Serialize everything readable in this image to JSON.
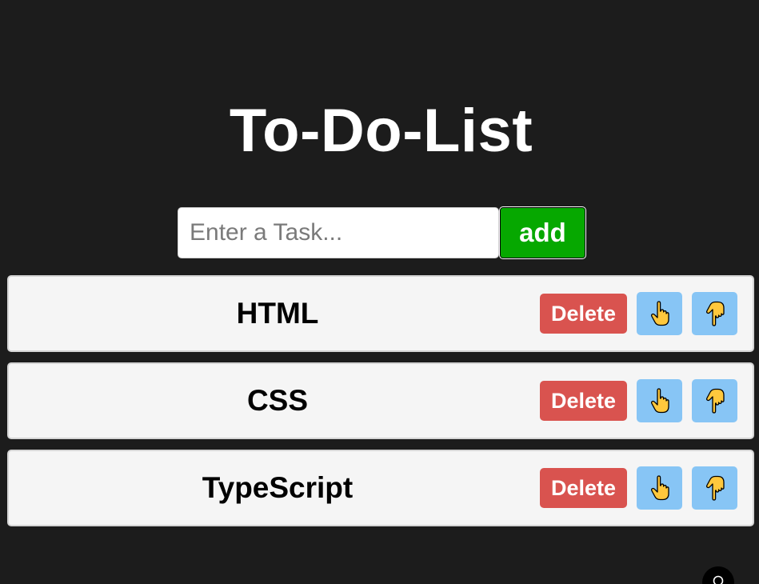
{
  "app": {
    "title": "To-Do-List"
  },
  "input": {
    "placeholder": "Enter a Task...",
    "value": "",
    "add_label": "add"
  },
  "tasks": [
    {
      "text": "HTML",
      "delete_label": "Delete",
      "up_icon": "hand-pointing-up-icon",
      "down_icon": "hand-pointing-down-icon"
    },
    {
      "text": "CSS",
      "delete_label": "Delete",
      "up_icon": "hand-pointing-up-icon",
      "down_icon": "hand-pointing-down-icon"
    },
    {
      "text": "TypeScript",
      "delete_label": "Delete",
      "up_icon": "hand-pointing-up-icon",
      "down_icon": "hand-pointing-down-icon"
    }
  ],
  "colors": {
    "background": "#1c1c1c",
    "add_button": "#06a800",
    "delete_button": "#d9534f",
    "move_button": "#87c5f5",
    "task_item": "#f5f5f5"
  }
}
